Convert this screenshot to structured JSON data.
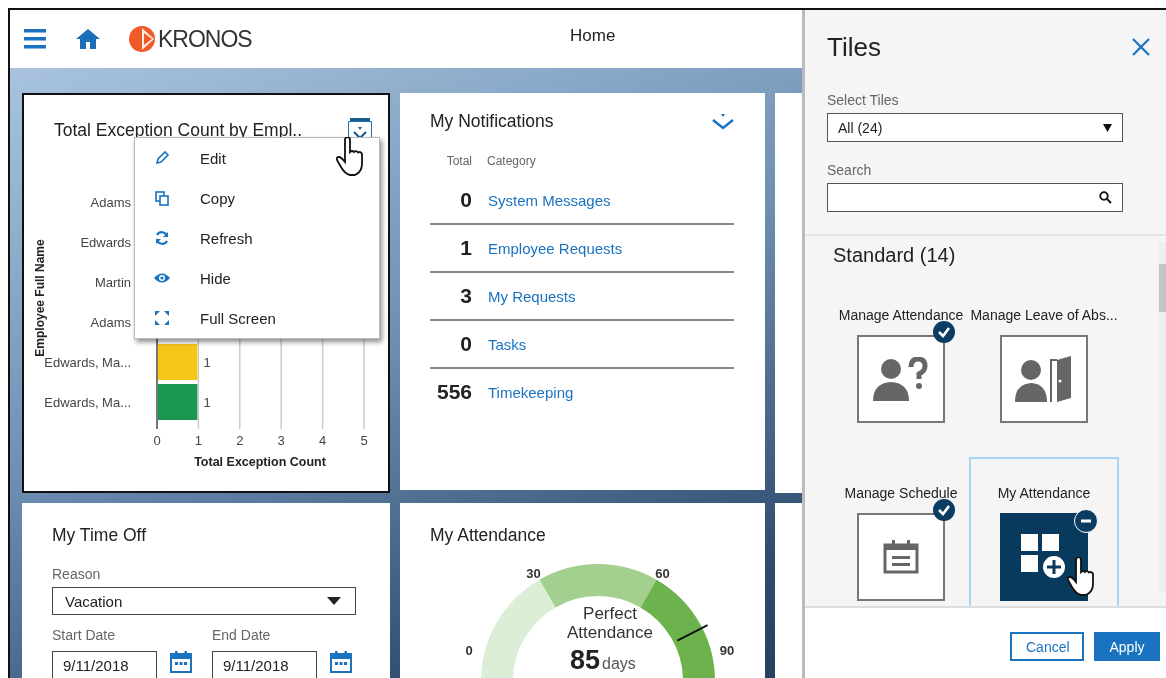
{
  "header": {
    "title": "Home",
    "logo_text": "KRONOS"
  },
  "exception_tile": {
    "title": "Total Exception Count by Empl..",
    "menu": {
      "open": true,
      "items": [
        {
          "label": "Edit"
        },
        {
          "label": "Copy"
        },
        {
          "label": "Refresh"
        },
        {
          "label": "Hide"
        },
        {
          "label": "Full Screen"
        }
      ]
    },
    "chart_data": {
      "type": "bar",
      "orientation": "horizontal",
      "xlabel": "Total Exception Count",
      "ylabel": "Employee Full Name",
      "categories": [
        "Adams",
        "Edwards",
        "Martin",
        "Adams",
        "Edwards, Ma...",
        "Edwards, Ma..."
      ],
      "series": [
        {
          "color": "#f6c719",
          "values": [
            null,
            null,
            null,
            null,
            1,
            null
          ]
        },
        {
          "color": "#1b9650",
          "values": [
            null,
            null,
            null,
            null,
            null,
            1
          ]
        }
      ],
      "grid": true,
      "xlim": [
        0,
        5
      ],
      "xticks": [
        0,
        1,
        2,
        3,
        4,
        5
      ],
      "data_labels": true
    }
  },
  "notifications_tile": {
    "title": "My Notifications",
    "columns": [
      "Total",
      "Category"
    ],
    "rows": [
      {
        "total": "0",
        "category": "System Messages"
      },
      {
        "total": "1",
        "category": "Employee Requests"
      },
      {
        "total": "3",
        "category": "My Requests"
      },
      {
        "total": "0",
        "category": "Tasks"
      },
      {
        "total": "556",
        "category": "Timekeeping"
      }
    ]
  },
  "time_off_tile": {
    "title": "My Time Off",
    "reason_label": "Reason",
    "reason_value": "Vacation",
    "start_label": "Start Date",
    "start_value": "9/11/2018",
    "end_label": "End Date",
    "end_value": "9/11/2018"
  },
  "attendance_tile": {
    "title": "My Attendance",
    "ticks": [
      "0",
      "30",
      "60",
      "90"
    ],
    "label": "Perfect Attendance",
    "value": "85",
    "unit": "days",
    "level": 0.85
  },
  "tiles_panel": {
    "title": "Tiles",
    "select_label": "Select Tiles",
    "select_value": "All (24)",
    "search_label": "Search",
    "section": "Standard (14)",
    "tiles": [
      {
        "name": "Manage Attendance",
        "added": true,
        "selected": false
      },
      {
        "name": "Manage Leave of Abs...",
        "added": false,
        "selected": false
      },
      {
        "name": "Manage Schedule",
        "added": true,
        "selected": false
      },
      {
        "name": "My Attendance",
        "added": true,
        "selected": true
      }
    ],
    "buttons": [
      {
        "label": "Cancel",
        "kind": "secondary"
      },
      {
        "label": "Apply",
        "kind": "primary"
      }
    ]
  }
}
